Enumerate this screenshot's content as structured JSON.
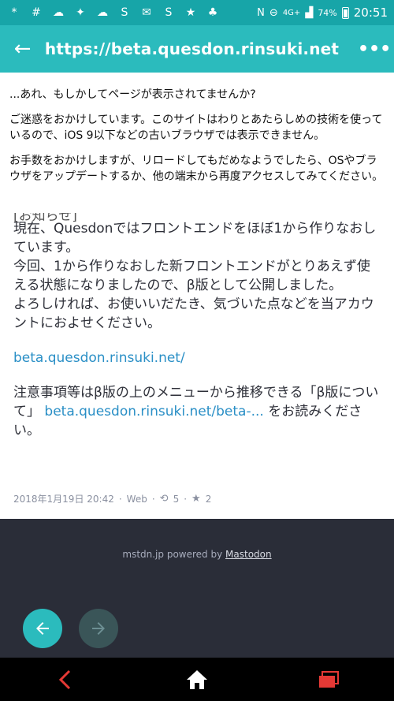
{
  "statusbar": {
    "icons": [
      "*",
      "#",
      "☁",
      "✦",
      "☁",
      "S",
      "✉",
      "S",
      "★",
      "♣"
    ],
    "network": "4G+",
    "battery": "74%",
    "time": "20:51"
  },
  "appbar": {
    "url": "https://beta.quesdon.rinsuki.net",
    "back_icon": "←",
    "menu_icon": "•••"
  },
  "notice": {
    "line1": "...あれ、もしかしてページが表示されてませんか?",
    "line2": "ご迷惑をおかけしています。このサイトはわりとあたらしめの技術を使っているので、iOS 9以下などの古いブラウザでは表示できません。",
    "line3": "お手数をおかけしますが、リロードしてもだめなようでしたら、OSやブラウザをアップデートするか、他の端末から再度アクセスしてみてください。"
  },
  "post": {
    "clipped_top": "[お知らせ]",
    "paragraph1": "現在、Quesdonではフロントエンドをほぼ1から作りなおしています。\n今回、1から作りなおした新フロントエンドがとりあえず使える状態になりましたので、β版として公開しました。\nよろしければ、お使いいだたき、気づいた点などを当アカウントにおよせください。",
    "link1": "beta.quesdon.rinsuki.net/",
    "paragraph2_pre": "注意事項等はβ版の上のメニューから推移できる「β版について」",
    "link2": "beta.quesdon.rinsuki.net/beta-...",
    "paragraph2_post": "をお読みください。",
    "timestamp": "2018年1月19日 20:42",
    "source": "Web",
    "boosts": "5",
    "favourites": "2"
  },
  "footer": {
    "instance": "mstdn.jp",
    "powered": "powered by",
    "mastodon": "Mastodon"
  }
}
